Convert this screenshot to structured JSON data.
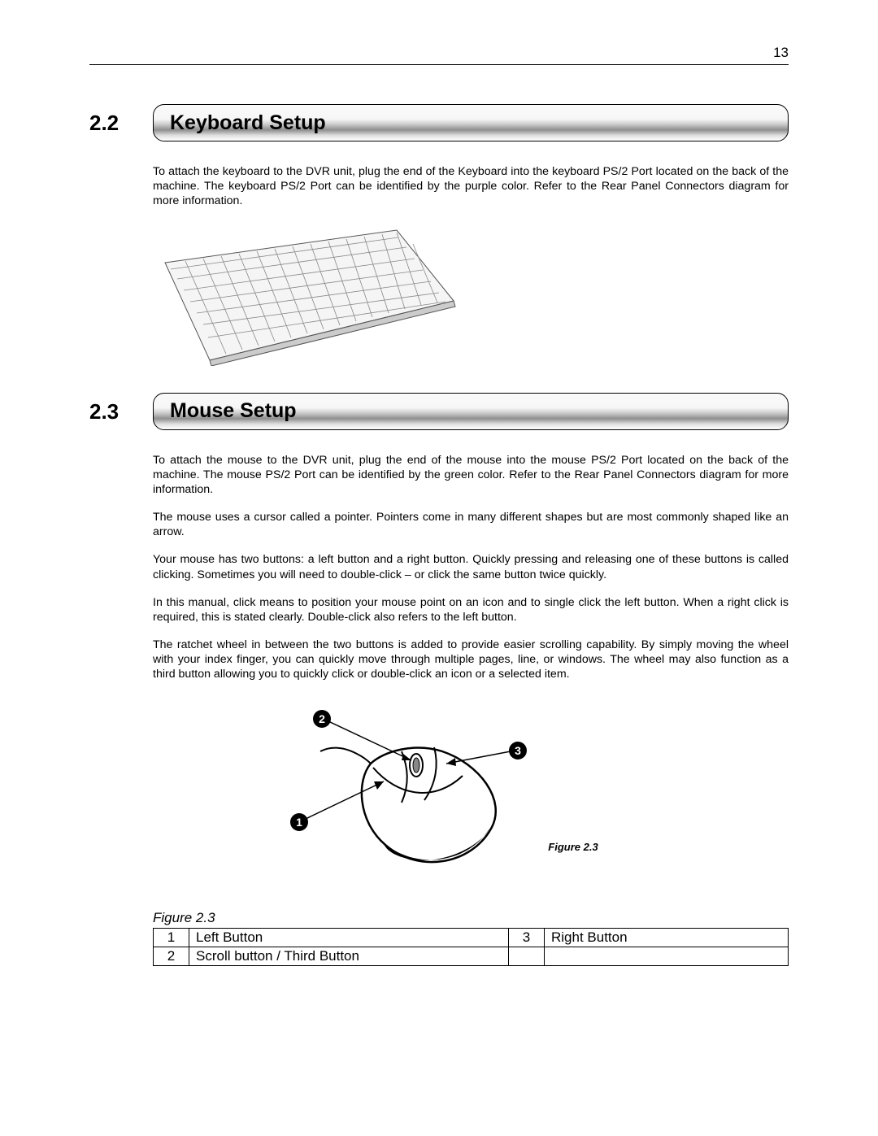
{
  "page_number": "13",
  "sections": [
    {
      "number": "2.2",
      "title": "Keyboard Setup",
      "paragraphs": [
        "To attach the keyboard to the DVR unit, plug the end of the Keyboard into the keyboard PS/2 Port located on the back of the machine. The keyboard PS/2 Port can be identified by the purple color. Refer to the Rear Panel Connectors diagram for more information."
      ],
      "illustration": "keyboard-illustration"
    },
    {
      "number": "2.3",
      "title": "Mouse Setup",
      "paragraphs": [
        "To attach the mouse to the DVR unit, plug the end of the mouse into the mouse PS/2 Port located on the back of the machine. The mouse PS/2 Port can be identified by the green color. Refer to the Rear Panel Connectors diagram for more information.",
        "The mouse uses a cursor called a pointer. Pointers come in many different shapes but are most commonly shaped like an arrow.",
        "Your mouse has two buttons: a left button and a right button. Quickly pressing and releasing one of these buttons is called clicking. Sometimes you will need to double-click – or click the same button twice quickly.",
        "In this manual, click means to position your mouse point on an icon and to single click the left button. When a right click is required, this is stated clearly. Double-click also refers to the left button.",
        "The ratchet wheel in between the two buttons is added to provide easier scrolling capability. By simply moving the wheel with your index finger, you can quickly move through multiple pages, line, or windows. The wheel may also function as a third button allowing you to quickly click or double-click an icon or a selected item."
      ],
      "illustration": "mouse-illustration",
      "illustration_caption": "Figure 2.3"
    }
  ],
  "legend": {
    "caption": "Figure 2.3",
    "rows": [
      {
        "n1": "1",
        "l1": "Left Button",
        "n2": "3",
        "l2": "Right Button"
      },
      {
        "n1": "2",
        "l1": "Scroll button / Third Button",
        "n2": "",
        "l2": ""
      }
    ]
  },
  "callouts": {
    "one": "1",
    "two": "2",
    "three": "3"
  }
}
